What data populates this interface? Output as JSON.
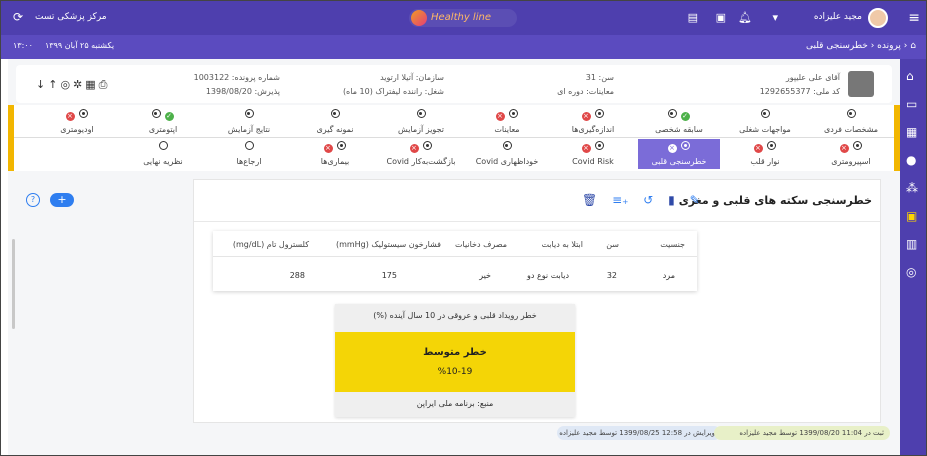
{
  "topbar": {
    "user_name": "مجید علیزاده",
    "center_name": "مرکز پزشکی تست",
    "logo_text": "Healthy line",
    "icons": [
      "menu-icon",
      "user-dropdown-icon",
      "bell-icon",
      "folder-icon",
      "message-icon",
      "refresh-icon"
    ]
  },
  "subbar": {
    "breadcrumb_home": "⌂",
    "breadcrumb_1": "پرونده",
    "breadcrumb_2": "خطرسنجی قلبی",
    "date": "یکشنبه ۲۵ آبان ۱۳۹۹",
    "time": "۱۳:۰۰"
  },
  "patient": {
    "name": "آقای علی علیپور",
    "national_code": "کد ملی: 1292655377",
    "age": "سن: 31",
    "visits": "معاینات: دوره ای",
    "org": "سازمان: آتیلا ارتوید",
    "job": "شغل: راننده لیفتراک (10 ماه)",
    "file_no": "شماره پرونده: 1003122",
    "admit_date": "پذیرش: 1398/08/20"
  },
  "tabs_row1": [
    {
      "label": "مشخصات فردی",
      "marks": "ring"
    },
    {
      "label": "مواجهات شغلی",
      "marks": "ring"
    },
    {
      "label": "سابقه شخصی",
      "marks": "ring-green"
    },
    {
      "label": "اندازه‌گیری‌ها",
      "marks": "red-ring"
    },
    {
      "label": "معاینات",
      "marks": "red-ring"
    },
    {
      "label": "تجویز آزمایش",
      "marks": "ring"
    },
    {
      "label": "نمونه گیری",
      "marks": "ring"
    },
    {
      "label": "نتایج آزمایش",
      "marks": "ring"
    },
    {
      "label": "اپتومتری",
      "marks": "ring-green"
    },
    {
      "label": "اودیومتری",
      "marks": "red-ring"
    }
  ],
  "tabs_row2": [
    {
      "label": "اسپیرومتری",
      "marks": "red-ring"
    },
    {
      "label": "نوار قلب",
      "marks": "red-ring"
    },
    {
      "label": "خطرسنجی قلبی",
      "marks": "red-ring",
      "active": true
    },
    {
      "label": "Covid Risk",
      "marks": "red-ring"
    },
    {
      "label": "خوداظهاری Covid",
      "marks": "ring"
    },
    {
      "label": "بازگشت‌به‌کار Covid",
      "marks": "red-ring"
    },
    {
      "label": "بیماری‌ها",
      "marks": "red-ring"
    },
    {
      "label": "ارجاع‌ها",
      "marks": "empty"
    },
    {
      "label": "نظریه نهایی",
      "marks": "empty"
    }
  ],
  "card": {
    "title": "خطرسنجی سکته های قلبی و مغزی",
    "action_icons": [
      "edit-icon",
      "clipboard-icon",
      "undo-icon",
      "playlist-add-icon",
      "delete-icon"
    ]
  },
  "table": {
    "headers": [
      "جنسیت",
      "سن",
      "ابتلا به دیابت",
      "مصرف دخانیات",
      "فشارخون سیستولیک (mmHg)",
      "کلسترول تام (mg/dL)"
    ],
    "row": [
      "مرد",
      "32",
      "دیابت نوع دو",
      "خیر",
      "175",
      "288"
    ]
  },
  "risk": {
    "header": "خطر رویداد قلبی و عروقی در 10 سال آینده (%)",
    "level": "خطر متوسط",
    "range": "%10-19",
    "source": "منبع: برنامه ملی ایراپن",
    "band_color": "#f4d506"
  },
  "footer": {
    "registered": "ثبت در 11:04 1399/08/20 توسط مجید علیزاده",
    "edited": "ویرایش در 12:58 1399/08/25 توسط مجید علیزاده"
  }
}
